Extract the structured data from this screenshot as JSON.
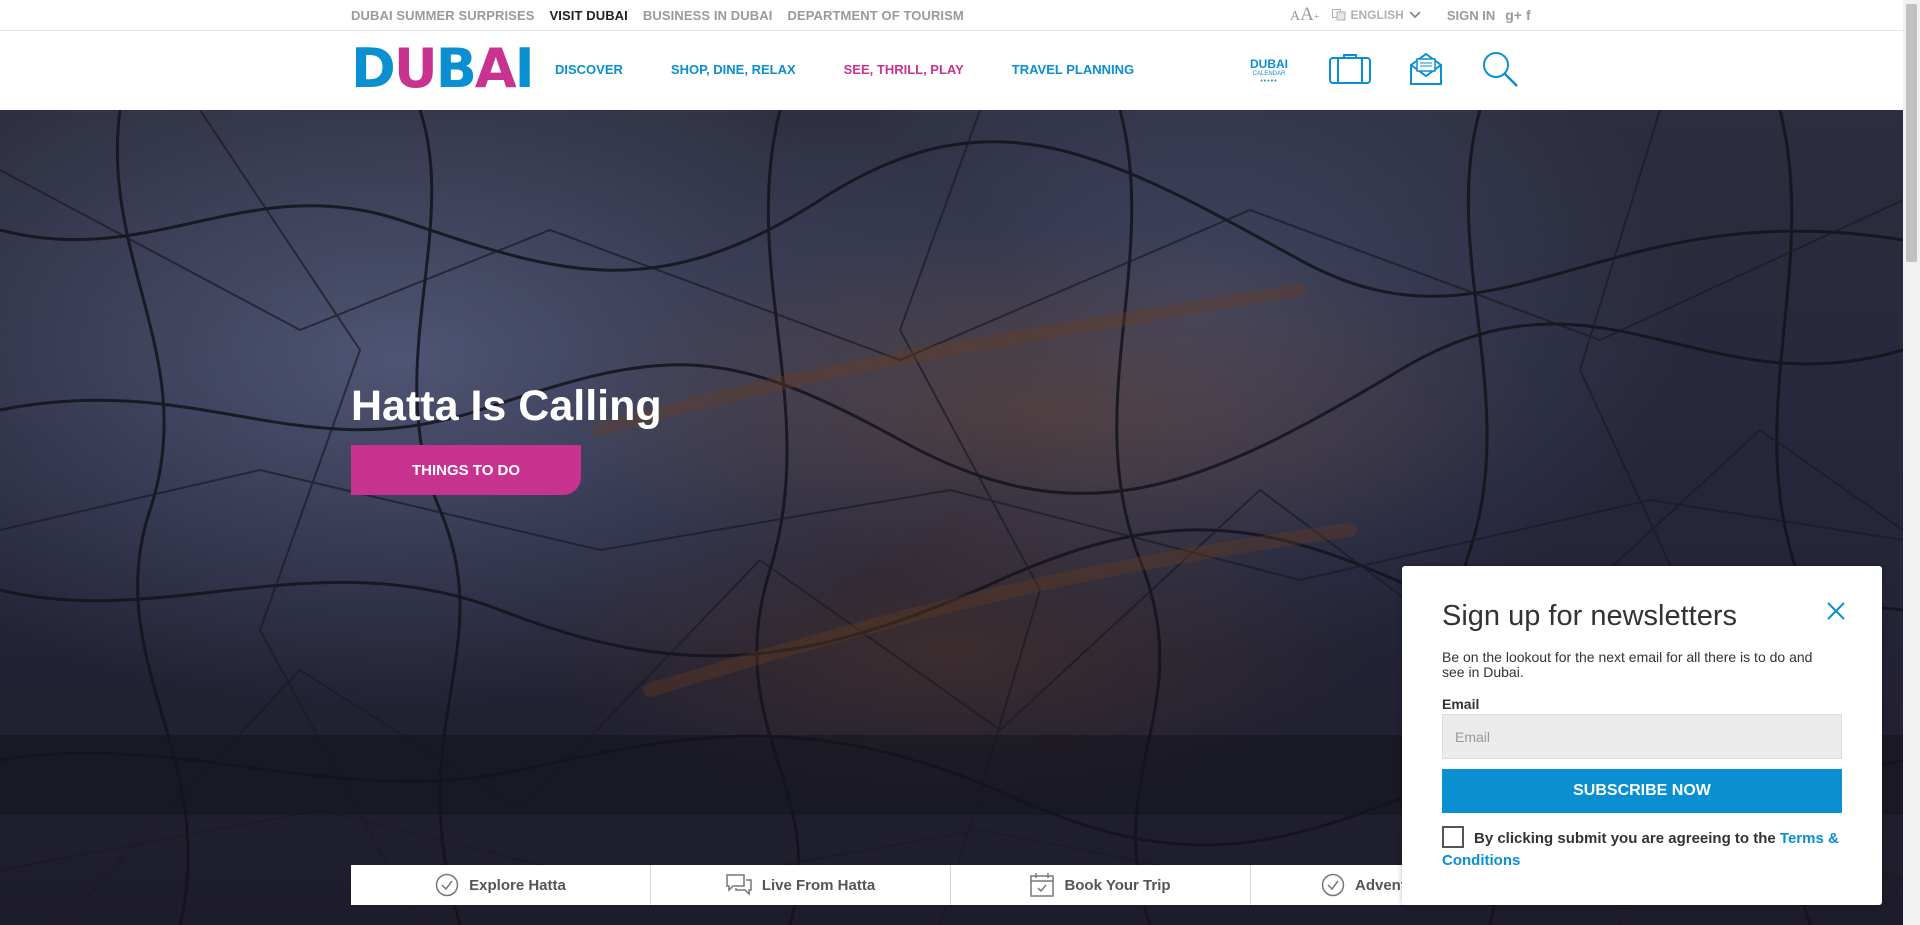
{
  "util_bar": {
    "links": [
      "DUBAI SUMMER SURPRISES",
      "VISIT DUBAI",
      "BUSINESS IN DUBAI",
      "DEPARTMENT OF TOURISM"
    ],
    "language": "ENGLISH",
    "sign_in": "SIGN IN",
    "google_plus": "g+",
    "facebook": "f"
  },
  "main_nav": {
    "logo": "DUBAI",
    "items": [
      "DISCOVER",
      "SHOP, DINE, RELAX",
      "SEE, THRILL, PLAY",
      "TRAVEL PLANNING"
    ],
    "calendar": {
      "line1": "DUBAI",
      "line2": "CALENDAR"
    },
    "icons": [
      "briefcase-icon",
      "mail-icon",
      "search-icon"
    ]
  },
  "hero": {
    "title": "Hatta Is Calling",
    "cta": "THINGS TO DO"
  },
  "tabs": [
    {
      "label": "Explore Hatta",
      "icon": "check-circle-icon"
    },
    {
      "label": "Live From Hatta",
      "icon": "chat-icon"
    },
    {
      "label": "Book Your Trip",
      "icon": "calendar-icon"
    },
    {
      "label": "Advent",
      "icon": "check-circle-icon"
    }
  ],
  "newsletter": {
    "title": "Sign up for newsletters",
    "description": "Be on the lookout for the next email for all there is to do and see in Dubai.",
    "email_label": "Email",
    "email_placeholder": "Email",
    "submit_label": "SUBSCRIBE NOW",
    "terms_text": "By clicking submit you are agreeing to the ",
    "terms_link": "Terms & Conditions"
  },
  "colors": {
    "blue": "#0a8fd0",
    "pink": "#c8338f",
    "hero_bg": "#25263a"
  }
}
